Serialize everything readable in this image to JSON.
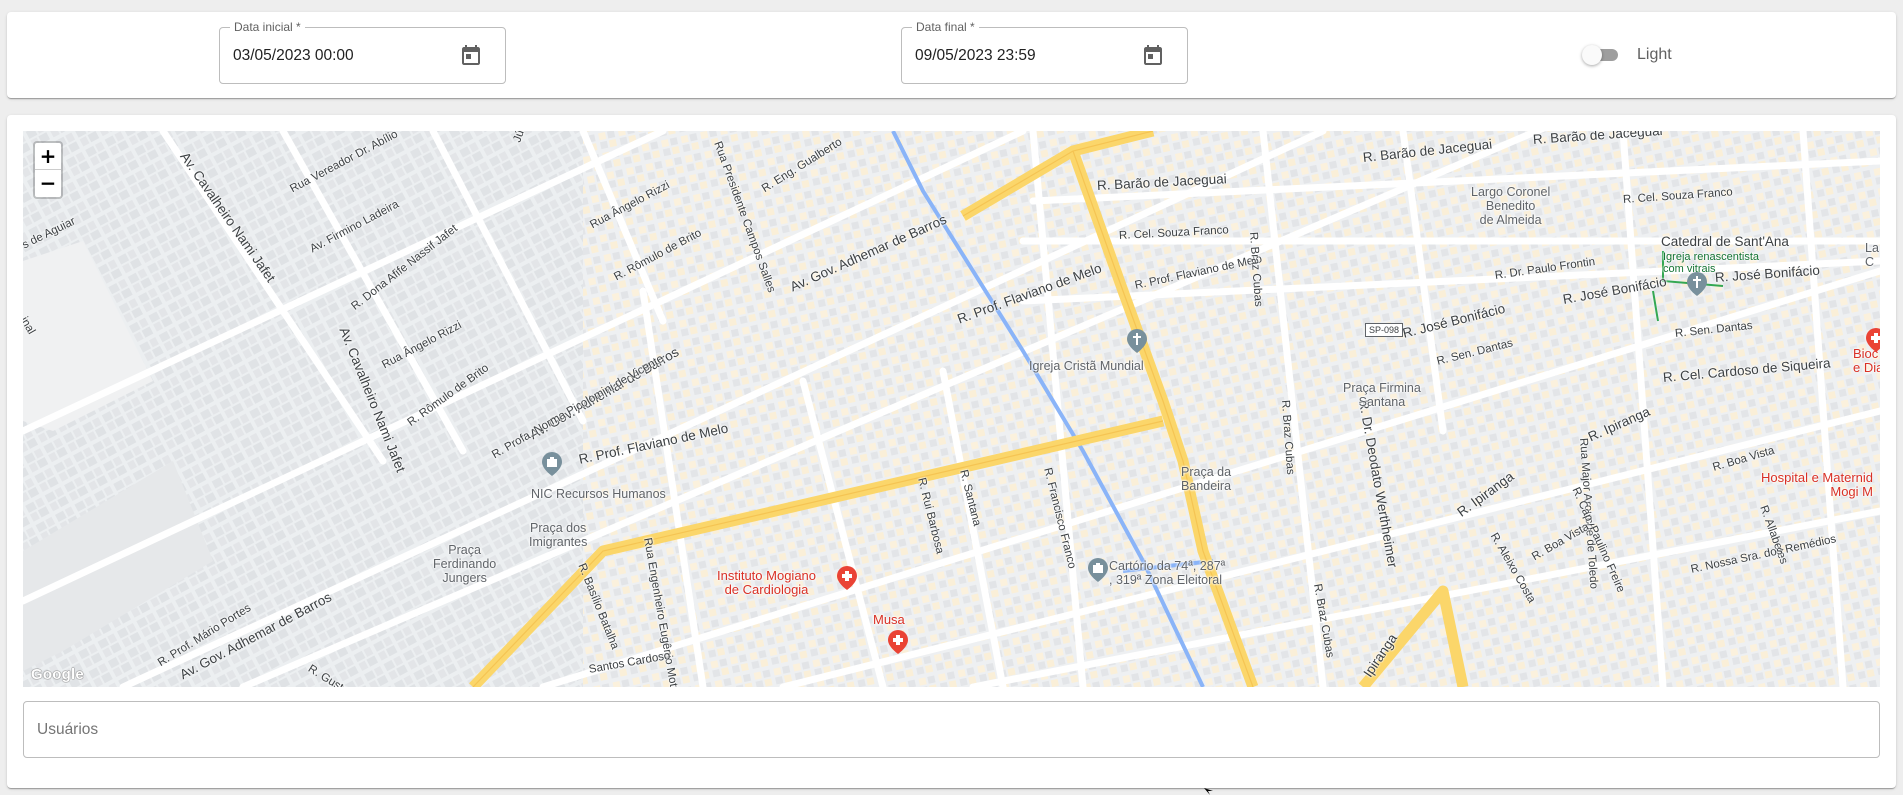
{
  "filters": {
    "start_label": "Data inicial *",
    "start_value": "03/05/2023 00:00",
    "end_label": "Data final *",
    "end_value": "09/05/2023 23:59"
  },
  "theme": {
    "label": "Light",
    "enabled": false
  },
  "map": {
    "zoom_in": "+",
    "zoom_out": "−",
    "attribution": "Google",
    "streets": {
      "av_adhemar_1": "Av. Gov. Adhemar de Barros",
      "av_adhemar_2": "Av. Gov. Adhemar de Barros",
      "av_adhemar_3": "Av. Gov. Adhemar de Barros",
      "av_cavalheiro_1": "Av. Cavalheiro Nami Jafet",
      "av_cavalheiro_2": "Av. Cavalheiro Nami Jafet",
      "av_firmino": "Av. Firmino Ladeira",
      "r_vereador": "Rua Vereador Dr. Abílio",
      "r_dona_afife": "R. Dona Afife Nassif Jafet",
      "r_angelo_1": "Rua Ângelo Rizzi",
      "r_angelo_2": "Rua Ângelo Rizzi",
      "r_angelo_3": "Rua Ângelo Rizzi",
      "r_romulo_1": "R. Rômulo de Brito",
      "r_romulo_2": "R. Rômulo de Brito",
      "r_profa_norma": "R. Profa. Norma Picolomini de Vicente",
      "r_presidente": "Rua Presidente Campos Salles",
      "r_eng_gualberto": "R. Eng. Gualberto",
      "r_flaviano_1": "R. Prof. Flaviano de Melo",
      "r_flaviano_2": "R. Prof. Flaviano de Melo",
      "r_flaviano_3": "R. Prof. Flaviano de Melo",
      "r_barao_1": "R. Barão de Jaceguai",
      "r_barao_2": "R. Barão de Jaceguai",
      "r_barao_3": "R. Barão de Jaceguai",
      "r_souza_1": "R. Cel. Souza Franco",
      "r_souza_2": "R. Cel. Souza Franco",
      "r_braz_1": "R. Braz Cubas",
      "r_braz_2": "R. Braz Cubas",
      "r_braz_3": "R. Braz Cubas",
      "r_paulo_frontin": "R. Dr. Paulo Frontin",
      "r_jose_1": "R. José Bonifácio",
      "r_jose_2": "R. José Bonifácio",
      "r_jose_3": "R. José Bonifácio",
      "r_dantas_1": "R. Sen. Dantas",
      "r_dantas_2": "R. Sen. Dantas",
      "r_cardoso": "R. Cel. Cardoso de Siqueira",
      "r_deodato": "R. Dr. Deodato Werthheimer",
      "r_ipiranga_1": "R. Ipiranga",
      "r_ipiranga_2": "R. Ipiranga",
      "r_ipiranga_3": "Ipiranga",
      "r_major": "Rua Major Arouche de Toledo",
      "r_boa_vista_1": "R. Boa Vista",
      "r_boa_vista_2": "R. Boa Vista",
      "r_cap_paulino": "R. Cap. Paulino Freire",
      "r_aleixo": "R. Aleixo Costa",
      "r_allabetes": "R. Allabetes",
      "r_nossa_sra": "R. Nossa Sra. dos Remédios",
      "r_rui": "R. Rui Barbosa",
      "r_santana": "R. Santana",
      "r_francisco": "R. Francisco Franco",
      "r_basilio": "R. Basílio Batalha",
      "r_eng_eugenio": "Rua Engenheiro Eugênio Motta",
      "r_santos": "Santos Cardoso",
      "r_mario": "R. Prof. Mário Portes",
      "r_gustavo": "R. Gustavo",
      "r_junior": "Júnior",
      "r_aguiar": "s de Aguiar",
      "r_inal": "inal",
      "shield_sp098": "SP-098"
    },
    "places": {
      "largo_coronel": "Largo Coronel\nBenedito\nde Almeida",
      "catedral": "Catedral de Sant'Ana",
      "catedral_sub": "Igreja renascentista\ncom vitrais",
      "igreja_crista": "Igreja Cristã Mundial",
      "praca_firmina": "Praça Firmina\nSantana",
      "praca_bandeira": "Praça da\nBandeira",
      "nic": "NIC Recursos Humanos",
      "praca_imigrantes": "Praça dos\nImigrantes",
      "praca_ferdinando": "Praça\nFerdinando\nJungers",
      "instituto": "Instituto Mogiano\nde Cardiologia",
      "musa": "Musa",
      "cartorio": "Cartório da 74ª, 287ª\n, 319ª Zona Eleitoral",
      "hospital": "Hospital e Maternid\nMogi M",
      "bioc": "Bioc\ne Dia",
      "la": "La\nC"
    }
  },
  "users": {
    "placeholder": "Usuários"
  }
}
